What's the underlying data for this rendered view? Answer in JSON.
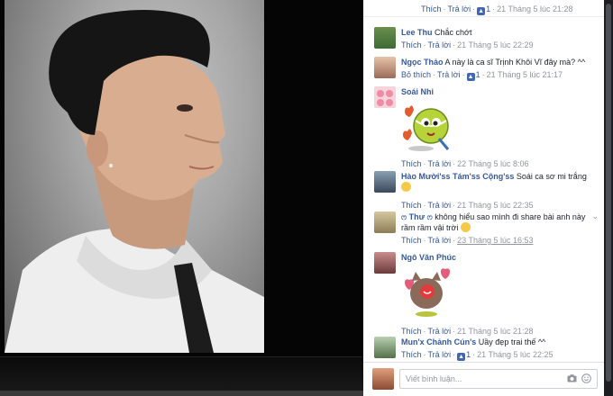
{
  "top_actions": {
    "like": "Thích",
    "reply": "Trả lời",
    "like_count": "1",
    "time": "21 Tháng 5 lúc 21:28"
  },
  "comments": [
    {
      "author": "Lee Thu",
      "text": "Chắc chớt",
      "like": "Thích",
      "reply": "Trả lời",
      "time": "21 Tháng 5 lúc 22:29"
    },
    {
      "author": "Ngọc Thảo",
      "text": "A này là ca sĩ Trịnh Khôi Vĩ đây mà? ^^",
      "like": "Bỏ thích",
      "reply": "Trả lời",
      "like_count": "1",
      "time": "21 Tháng 5 lúc 21:17"
    },
    {
      "author": "Soái Nhi",
      "text": "",
      "like": "Thích",
      "reply": "Trả lời",
      "time": "22 Tháng 5 lúc 8:06",
      "sticker": "tennis-ball-sticker"
    },
    {
      "author": "Hào Mười'ss Tám'ss Cộng'ss",
      "text": "Soái ca sơ mi trắng",
      "like": "Thích",
      "reply": "Trả lời",
      "time": "21 Tháng 5 lúc 22:35"
    },
    {
      "author": "ෆ Thư ෆ",
      "text": "không hiểu sao mình đi share bài anh này rầm rầm vậi trời",
      "like": "Thích",
      "reply": "Trả lời",
      "time": "23 Tháng 5 lúc 16:53"
    },
    {
      "author": "Ngô Văn Phúc",
      "text": "",
      "like": "Thích",
      "reply": "Trả lời",
      "time": "21 Tháng 5 lúc 21:28",
      "sticker": "heart-cat-sticker"
    },
    {
      "author": "Mun'x Chảnh Cún's",
      "text": "Uầy đẹp trai thế ^^",
      "like": "Thích",
      "reply": "Trả lời",
      "like_count": "1",
      "time": "21 Tháng 5 lúc 22:25"
    }
  ],
  "composer": {
    "placeholder": "Viết bình luận..."
  },
  "colors": {
    "link": "#365899",
    "meta": "#90949c",
    "like_blue": "#4267b2"
  }
}
